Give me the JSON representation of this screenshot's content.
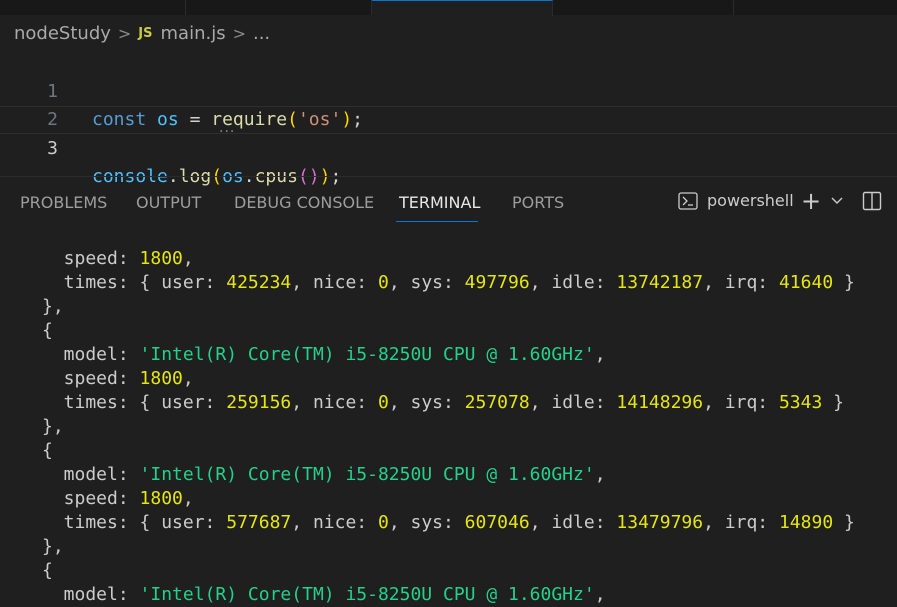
{
  "breadcrumb": {
    "folder": "nodeStudy",
    "file_badge": "JS",
    "file": "main.js",
    "more": "..."
  },
  "editor": {
    "lines": [
      {
        "num": "1",
        "tokens": [
          "const",
          "os",
          "=",
          "require",
          "(",
          "'os'",
          ")",
          ";"
        ]
      },
      {
        "num": "2",
        "tokens": []
      },
      {
        "num": "3",
        "tokens": [
          "console",
          ".",
          "log",
          "(",
          "os",
          ".",
          "cpus",
          "(",
          ")",
          ")",
          ";"
        ]
      }
    ]
  },
  "panel": {
    "tabs": [
      "PROBLEMS",
      "OUTPUT",
      "DEBUG CONSOLE",
      "TERMINAL",
      "PORTS"
    ],
    "active_tab": "TERMINAL",
    "terminal_name": "powershell"
  },
  "terminal": {
    "lines": [
      [
        {
          "t": "  speed: "
        },
        {
          "t": "1800",
          "c": "n"
        },
        {
          "t": ","
        }
      ],
      [
        {
          "t": "  times: { user: "
        },
        {
          "t": "425234",
          "c": "n"
        },
        {
          "t": ", nice: "
        },
        {
          "t": "0",
          "c": "n"
        },
        {
          "t": ", sys: "
        },
        {
          "t": "497796",
          "c": "n"
        },
        {
          "t": ", idle: "
        },
        {
          "t": "13742187",
          "c": "n"
        },
        {
          "t": ", irq: "
        },
        {
          "t": "41640",
          "c": "n"
        },
        {
          "t": " }"
        }
      ],
      [
        {
          "t": "},"
        }
      ],
      [
        {
          "t": "{"
        }
      ],
      [
        {
          "t": "  model: "
        },
        {
          "t": "'Intel(R) Core(TM) i5-8250U CPU @ 1.60GHz'",
          "c": "s"
        },
        {
          "t": ","
        }
      ],
      [
        {
          "t": "  speed: "
        },
        {
          "t": "1800",
          "c": "n"
        },
        {
          "t": ","
        }
      ],
      [
        {
          "t": "  times: { user: "
        },
        {
          "t": "259156",
          "c": "n"
        },
        {
          "t": ", nice: "
        },
        {
          "t": "0",
          "c": "n"
        },
        {
          "t": ", sys: "
        },
        {
          "t": "257078",
          "c": "n"
        },
        {
          "t": ", idle: "
        },
        {
          "t": "14148296",
          "c": "n"
        },
        {
          "t": ", irq: "
        },
        {
          "t": "5343",
          "c": "n"
        },
        {
          "t": " }"
        }
      ],
      [
        {
          "t": "},"
        }
      ],
      [
        {
          "t": "{"
        }
      ],
      [
        {
          "t": "  model: "
        },
        {
          "t": "'Intel(R) Core(TM) i5-8250U CPU @ 1.60GHz'",
          "c": "s"
        },
        {
          "t": ","
        }
      ],
      [
        {
          "t": "  speed: "
        },
        {
          "t": "1800",
          "c": "n"
        },
        {
          "t": ","
        }
      ],
      [
        {
          "t": "  times: { user: "
        },
        {
          "t": "577687",
          "c": "n"
        },
        {
          "t": ", nice: "
        },
        {
          "t": "0",
          "c": "n"
        },
        {
          "t": ", sys: "
        },
        {
          "t": "607046",
          "c": "n"
        },
        {
          "t": ", idle: "
        },
        {
          "t": "13479796",
          "c": "n"
        },
        {
          "t": ", irq: "
        },
        {
          "t": "14890",
          "c": "n"
        },
        {
          "t": " }"
        }
      ],
      [
        {
          "t": "},"
        }
      ],
      [
        {
          "t": "{"
        }
      ],
      [
        {
          "t": "  model: "
        },
        {
          "t": "'Intel(R) Core(TM) i5-8250U CPU @ 1.60GHz'",
          "c": "s"
        },
        {
          "t": ","
        }
      ]
    ]
  },
  "icons": {
    "terminal": "terminal-icon",
    "new": "plus-icon",
    "dropdown": "chevron-down-icon",
    "split": "split-icon"
  }
}
